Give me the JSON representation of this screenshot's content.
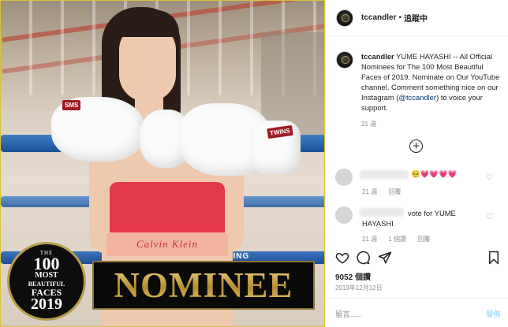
{
  "photo": {
    "badge": {
      "line1": "THE",
      "line2": "100",
      "line3": "MOST",
      "line4": "BEAUTIFUL",
      "line5": "FACES",
      "line6": "2019"
    },
    "nominee_text": "NOMINEE",
    "left_glove_label": "SMS",
    "right_glove_label": "TWINS",
    "bra_text": "Calvin Klein",
    "rope_banner": "DA BOXING"
  },
  "header": {
    "username": "tccandler",
    "separator": "•",
    "follow_status": "追蹤中"
  },
  "caption": {
    "username": "tccandler",
    "text_before_mention": "YUME HAYASHI -- All Official Nominees for The 100 Most Beautiful Faces of 2019. Nominate on Our YouTube channel. Comment something nice on our Instagram (",
    "mention": "@tccandler",
    "text_after_mention": ") to voice your support.",
    "time": "21 週"
  },
  "comments": [
    {
      "emoji_text": "🥺💗💗💗💗",
      "time": "21 週",
      "reply_label": "回覆"
    },
    {
      "text_line1": "vote for YUME",
      "text_line2": "HAYASHI",
      "time": "21 週",
      "likes": "1 個讚",
      "reply_label": "回覆"
    }
  ],
  "likes_text": "9052 個讚",
  "date": "2019年12月12日",
  "comment_input": {
    "placeholder": "留言......",
    "post_label": "發佈"
  },
  "colors": {
    "text": "#262626",
    "muted": "#8e8e8e",
    "mention": "#00376b",
    "post_disabled": "#b2dffc",
    "photo_border": "#d8c23a"
  },
  "icons": {
    "heart": "heart-icon",
    "comment": "comment-icon",
    "share": "share-icon",
    "save": "bookmark-icon",
    "more_comments": "plus-circle-icon"
  }
}
